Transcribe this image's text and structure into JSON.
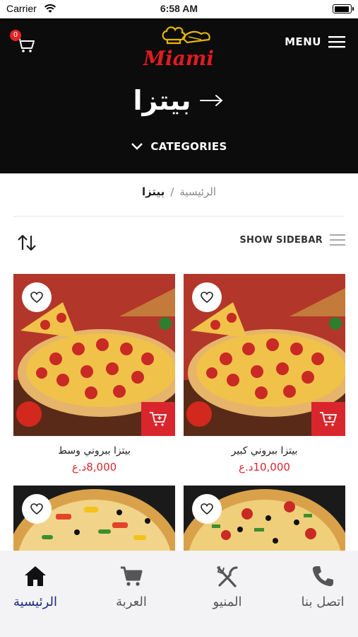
{
  "status_bar": {
    "carrier": "Carrier",
    "time": "6:58 AM",
    "battery_level": 0.95
  },
  "header": {
    "cart_count": "0",
    "brand": "Miami",
    "menu_label": "MENU",
    "page_title": "بيتزا",
    "categories_label": "CATEGORIES"
  },
  "breadcrumb": {
    "home": "الرئيسية",
    "separator": "/",
    "current": "بيتزا"
  },
  "toolbar": {
    "sidebar_label": "SHOW SIDEBAR"
  },
  "products": [
    {
      "name": "بيتزا ببروني كبير",
      "price": "10,000د.ع"
    },
    {
      "name": "بيتزا ببروني وسط",
      "price": "8,000د.ع"
    },
    {
      "name": "",
      "price": ""
    },
    {
      "name": "",
      "price": ""
    }
  ],
  "tabbar": {
    "tabs": [
      {
        "label": "الرئيسية",
        "icon": "home-icon",
        "active": true
      },
      {
        "label": "العربة",
        "icon": "cart-icon",
        "active": false
      },
      {
        "label": "المنيو",
        "icon": "utensils-icon",
        "active": false
      },
      {
        "label": "اتصل بنا",
        "icon": "phone-icon",
        "active": false
      }
    ]
  },
  "colors": {
    "accent": "#d8262c",
    "header_bg": "#0c0c0c",
    "active_tab": "#1a2a80"
  }
}
